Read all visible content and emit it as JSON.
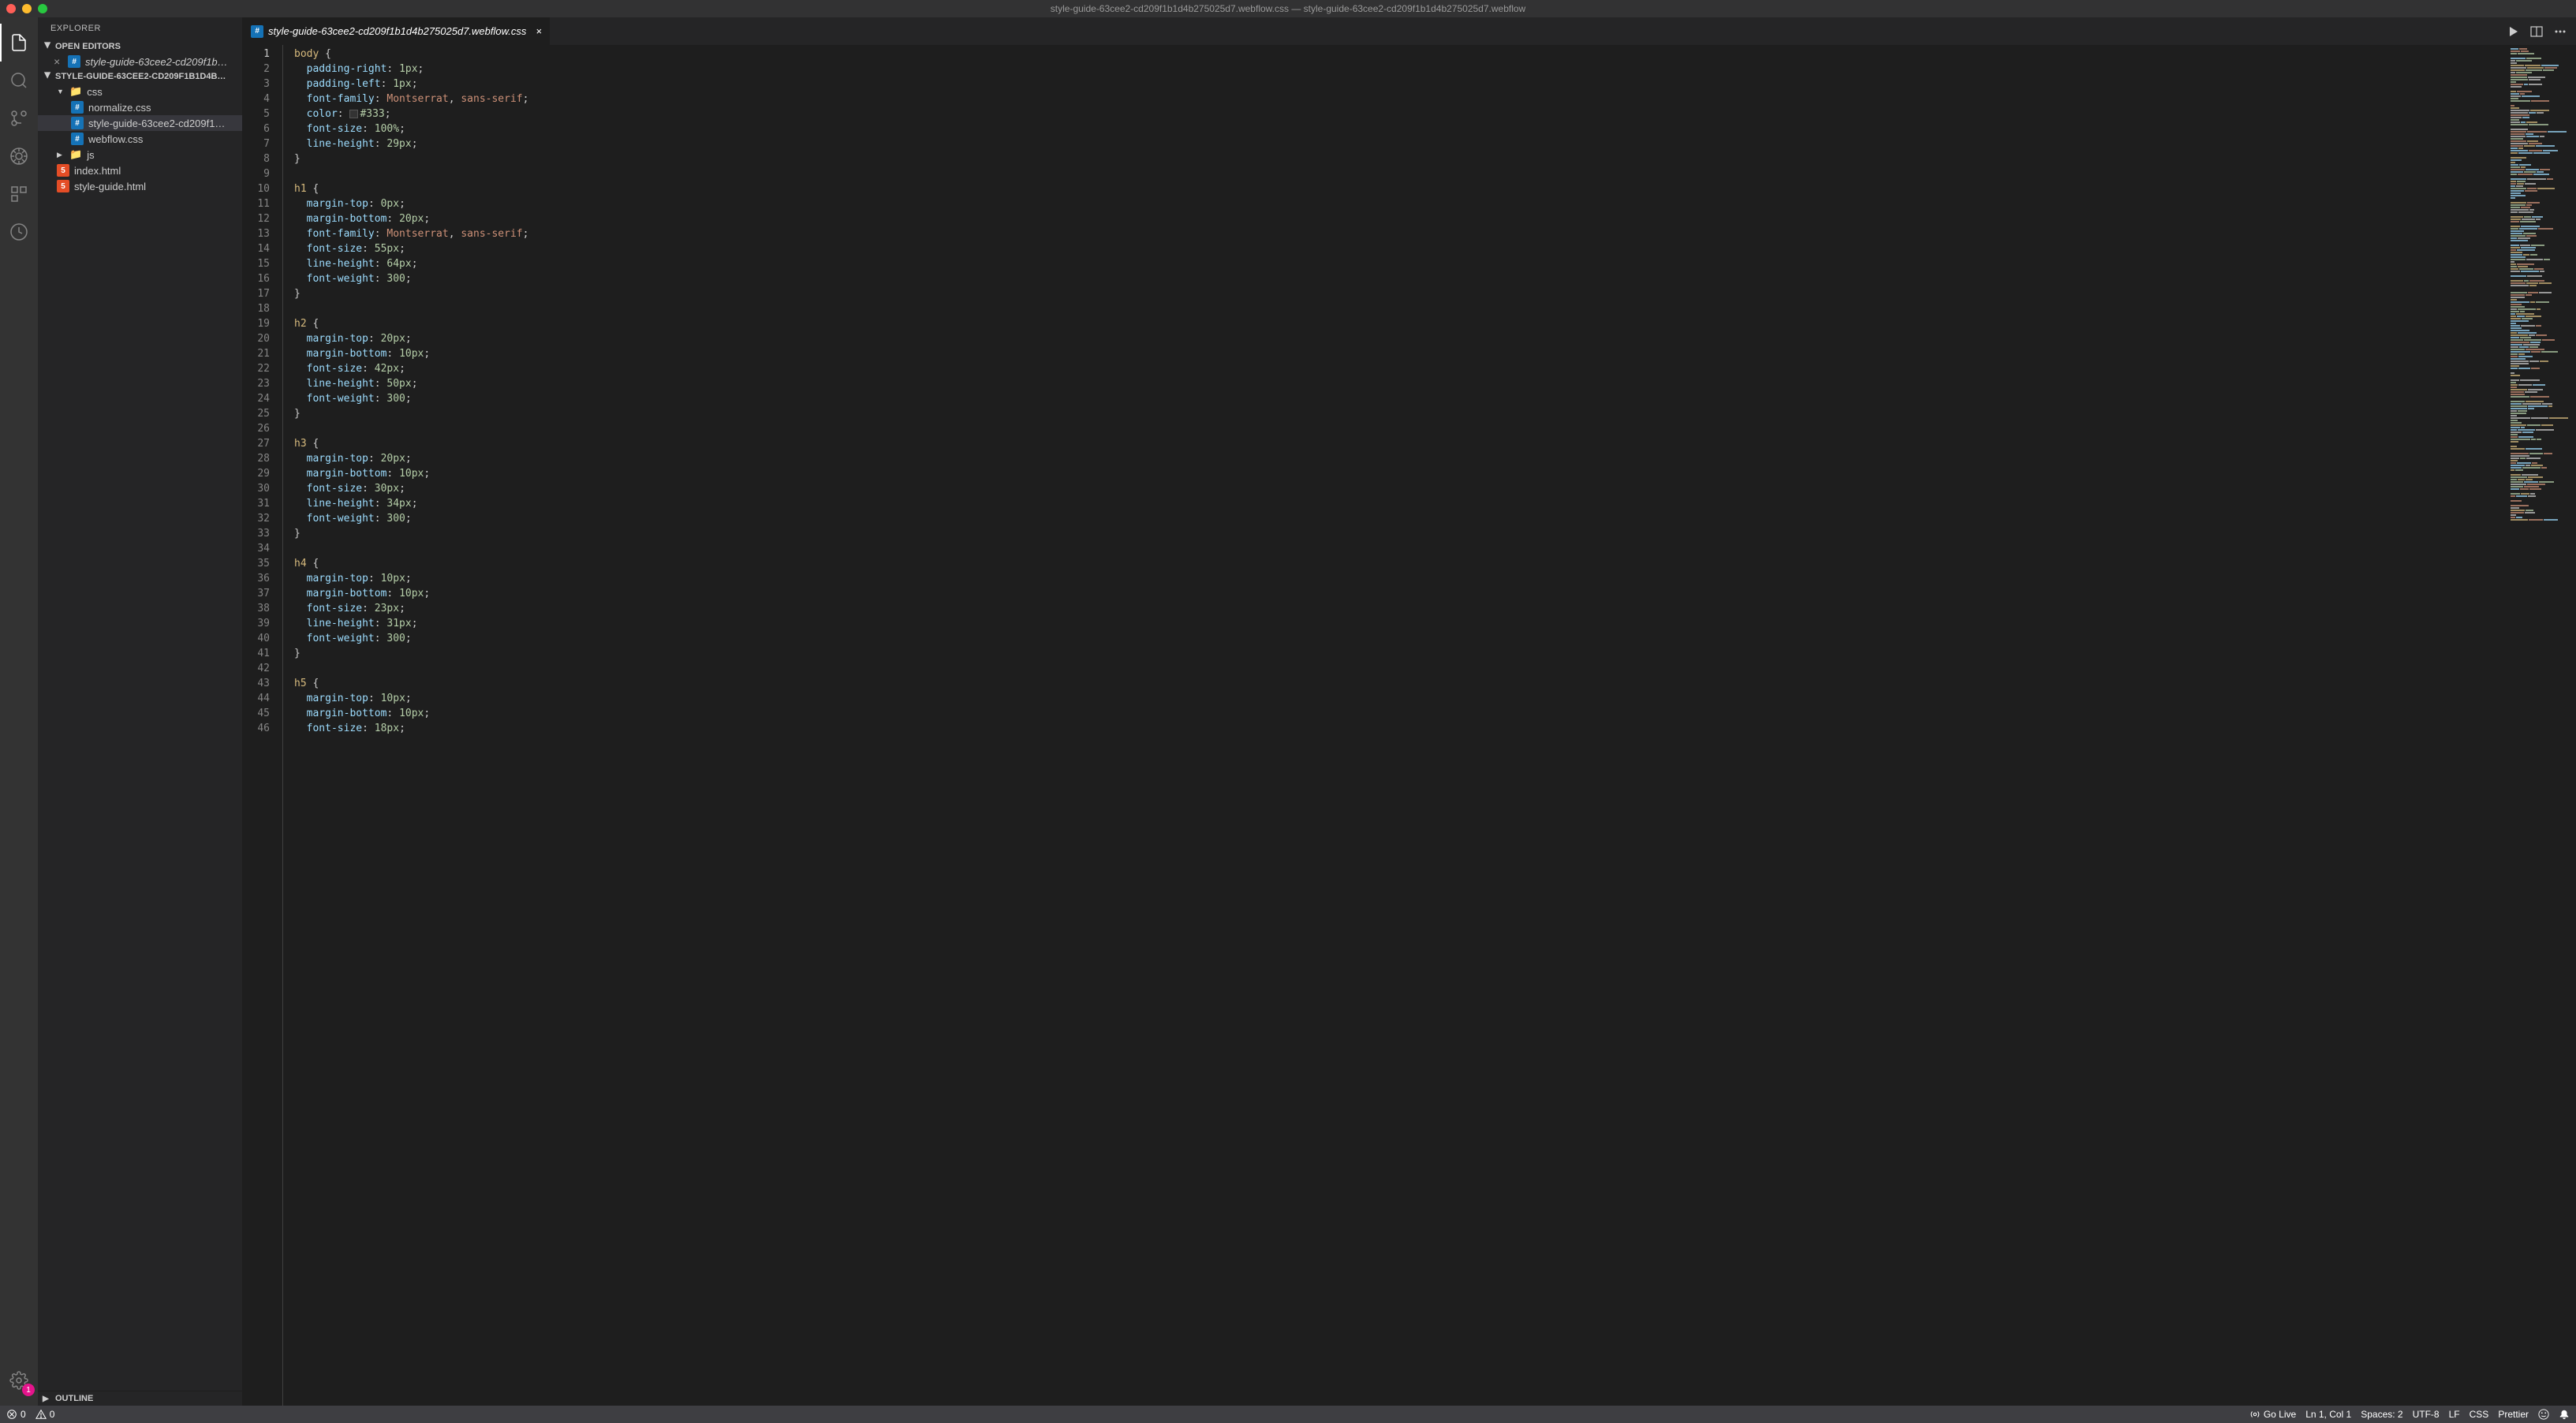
{
  "titlebar": {
    "title": "style-guide-63cee2-cd209f1b1d4b275025d7.webflow.css — style-guide-63cee2-cd209f1b1d4b275025d7.webflow"
  },
  "sidebar": {
    "title": "EXPLORER",
    "open_editors_label": "OPEN EDITORS",
    "open_editors": [
      {
        "name": "style-guide-63cee2-cd209f1b…",
        "icon": "css"
      }
    ],
    "workspace_name": "STYLE-GUIDE-63CEE2-CD209F1B1D4B…",
    "tree": [
      {
        "type": "folder",
        "name": "css",
        "indent": 1,
        "expanded": true,
        "root": true
      },
      {
        "type": "file",
        "name": "normalize.css",
        "icon": "css",
        "indent": 2
      },
      {
        "type": "file",
        "name": "style-guide-63cee2-cd209f1…",
        "icon": "css",
        "indent": 2,
        "active": true
      },
      {
        "type": "file",
        "name": "webflow.css",
        "icon": "css",
        "indent": 2
      },
      {
        "type": "folder",
        "name": "js",
        "indent": 1,
        "expanded": false
      },
      {
        "type": "file",
        "name": "index.html",
        "icon": "html",
        "indent": 1
      },
      {
        "type": "file",
        "name": "style-guide.html",
        "icon": "html",
        "indent": 1
      }
    ],
    "outline_label": "OUTLINE"
  },
  "tabs": [
    {
      "name": "style-guide-63cee2-cd209f1b1d4b275025d7.webflow.css",
      "icon": "css",
      "active": true
    }
  ],
  "code_lines": [
    [
      [
        "sel",
        "body"
      ],
      [
        "punc",
        " {"
      ]
    ],
    [
      [
        "punc",
        "  "
      ],
      [
        "prop",
        "padding-right"
      ],
      [
        "punc",
        ": "
      ],
      [
        "num",
        "1px"
      ],
      [
        "punc",
        ";"
      ]
    ],
    [
      [
        "punc",
        "  "
      ],
      [
        "prop",
        "padding-left"
      ],
      [
        "punc",
        ": "
      ],
      [
        "num",
        "1px"
      ],
      [
        "punc",
        ";"
      ]
    ],
    [
      [
        "punc",
        "  "
      ],
      [
        "prop",
        "font-family"
      ],
      [
        "punc",
        ": "
      ],
      [
        "str",
        "Montserrat"
      ],
      [
        "punc",
        ", "
      ],
      [
        "str",
        "sans-serif"
      ],
      [
        "punc",
        ";"
      ]
    ],
    [
      [
        "punc",
        "  "
      ],
      [
        "prop",
        "color"
      ],
      [
        "punc",
        ": "
      ],
      [
        "swatch",
        ""
      ],
      [
        "num",
        "#333"
      ],
      [
        "punc",
        ";"
      ]
    ],
    [
      [
        "punc",
        "  "
      ],
      [
        "prop",
        "font-size"
      ],
      [
        "punc",
        ": "
      ],
      [
        "num",
        "100%"
      ],
      [
        "punc",
        ";"
      ]
    ],
    [
      [
        "punc",
        "  "
      ],
      [
        "prop",
        "line-height"
      ],
      [
        "punc",
        ": "
      ],
      [
        "num",
        "29px"
      ],
      [
        "punc",
        ";"
      ]
    ],
    [
      [
        "punc",
        "}"
      ]
    ],
    [],
    [
      [
        "sel",
        "h1"
      ],
      [
        "punc",
        " {"
      ]
    ],
    [
      [
        "punc",
        "  "
      ],
      [
        "prop",
        "margin-top"
      ],
      [
        "punc",
        ": "
      ],
      [
        "num",
        "0px"
      ],
      [
        "punc",
        ";"
      ]
    ],
    [
      [
        "punc",
        "  "
      ],
      [
        "prop",
        "margin-bottom"
      ],
      [
        "punc",
        ": "
      ],
      [
        "num",
        "20px"
      ],
      [
        "punc",
        ";"
      ]
    ],
    [
      [
        "punc",
        "  "
      ],
      [
        "prop",
        "font-family"
      ],
      [
        "punc",
        ": "
      ],
      [
        "str",
        "Montserrat"
      ],
      [
        "punc",
        ", "
      ],
      [
        "str",
        "sans-serif"
      ],
      [
        "punc",
        ";"
      ]
    ],
    [
      [
        "punc",
        "  "
      ],
      [
        "prop",
        "font-size"
      ],
      [
        "punc",
        ": "
      ],
      [
        "num",
        "55px"
      ],
      [
        "punc",
        ";"
      ]
    ],
    [
      [
        "punc",
        "  "
      ],
      [
        "prop",
        "line-height"
      ],
      [
        "punc",
        ": "
      ],
      [
        "num",
        "64px"
      ],
      [
        "punc",
        ";"
      ]
    ],
    [
      [
        "punc",
        "  "
      ],
      [
        "prop",
        "font-weight"
      ],
      [
        "punc",
        ": "
      ],
      [
        "num",
        "300"
      ],
      [
        "punc",
        ";"
      ]
    ],
    [
      [
        "punc",
        "}"
      ]
    ],
    [],
    [
      [
        "sel",
        "h2"
      ],
      [
        "punc",
        " {"
      ]
    ],
    [
      [
        "punc",
        "  "
      ],
      [
        "prop",
        "margin-top"
      ],
      [
        "punc",
        ": "
      ],
      [
        "num",
        "20px"
      ],
      [
        "punc",
        ";"
      ]
    ],
    [
      [
        "punc",
        "  "
      ],
      [
        "prop",
        "margin-bottom"
      ],
      [
        "punc",
        ": "
      ],
      [
        "num",
        "10px"
      ],
      [
        "punc",
        ";"
      ]
    ],
    [
      [
        "punc",
        "  "
      ],
      [
        "prop",
        "font-size"
      ],
      [
        "punc",
        ": "
      ],
      [
        "num",
        "42px"
      ],
      [
        "punc",
        ";"
      ]
    ],
    [
      [
        "punc",
        "  "
      ],
      [
        "prop",
        "line-height"
      ],
      [
        "punc",
        ": "
      ],
      [
        "num",
        "50px"
      ],
      [
        "punc",
        ";"
      ]
    ],
    [
      [
        "punc",
        "  "
      ],
      [
        "prop",
        "font-weight"
      ],
      [
        "punc",
        ": "
      ],
      [
        "num",
        "300"
      ],
      [
        "punc",
        ";"
      ]
    ],
    [
      [
        "punc",
        "}"
      ]
    ],
    [],
    [
      [
        "sel",
        "h3"
      ],
      [
        "punc",
        " {"
      ]
    ],
    [
      [
        "punc",
        "  "
      ],
      [
        "prop",
        "margin-top"
      ],
      [
        "punc",
        ": "
      ],
      [
        "num",
        "20px"
      ],
      [
        "punc",
        ";"
      ]
    ],
    [
      [
        "punc",
        "  "
      ],
      [
        "prop",
        "margin-bottom"
      ],
      [
        "punc",
        ": "
      ],
      [
        "num",
        "10px"
      ],
      [
        "punc",
        ";"
      ]
    ],
    [
      [
        "punc",
        "  "
      ],
      [
        "prop",
        "font-size"
      ],
      [
        "punc",
        ": "
      ],
      [
        "num",
        "30px"
      ],
      [
        "punc",
        ";"
      ]
    ],
    [
      [
        "punc",
        "  "
      ],
      [
        "prop",
        "line-height"
      ],
      [
        "punc",
        ": "
      ],
      [
        "num",
        "34px"
      ],
      [
        "punc",
        ";"
      ]
    ],
    [
      [
        "punc",
        "  "
      ],
      [
        "prop",
        "font-weight"
      ],
      [
        "punc",
        ": "
      ],
      [
        "num",
        "300"
      ],
      [
        "punc",
        ";"
      ]
    ],
    [
      [
        "punc",
        "}"
      ]
    ],
    [],
    [
      [
        "sel",
        "h4"
      ],
      [
        "punc",
        " {"
      ]
    ],
    [
      [
        "punc",
        "  "
      ],
      [
        "prop",
        "margin-top"
      ],
      [
        "punc",
        ": "
      ],
      [
        "num",
        "10px"
      ],
      [
        "punc",
        ";"
      ]
    ],
    [
      [
        "punc",
        "  "
      ],
      [
        "prop",
        "margin-bottom"
      ],
      [
        "punc",
        ": "
      ],
      [
        "num",
        "10px"
      ],
      [
        "punc",
        ";"
      ]
    ],
    [
      [
        "punc",
        "  "
      ],
      [
        "prop",
        "font-size"
      ],
      [
        "punc",
        ": "
      ],
      [
        "num",
        "23px"
      ],
      [
        "punc",
        ";"
      ]
    ],
    [
      [
        "punc",
        "  "
      ],
      [
        "prop",
        "line-height"
      ],
      [
        "punc",
        ": "
      ],
      [
        "num",
        "31px"
      ],
      [
        "punc",
        ";"
      ]
    ],
    [
      [
        "punc",
        "  "
      ],
      [
        "prop",
        "font-weight"
      ],
      [
        "punc",
        ": "
      ],
      [
        "num",
        "300"
      ],
      [
        "punc",
        ";"
      ]
    ],
    [
      [
        "punc",
        "}"
      ]
    ],
    [],
    [
      [
        "sel",
        "h5"
      ],
      [
        "punc",
        " {"
      ]
    ],
    [
      [
        "punc",
        "  "
      ],
      [
        "prop",
        "margin-top"
      ],
      [
        "punc",
        ": "
      ],
      [
        "num",
        "10px"
      ],
      [
        "punc",
        ";"
      ]
    ],
    [
      [
        "punc",
        "  "
      ],
      [
        "prop",
        "margin-bottom"
      ],
      [
        "punc",
        ": "
      ],
      [
        "num",
        "10px"
      ],
      [
        "punc",
        ";"
      ]
    ],
    [
      [
        "punc",
        "  "
      ],
      [
        "prop",
        "font-size"
      ],
      [
        "punc",
        ": "
      ],
      [
        "num",
        "18px"
      ],
      [
        "punc",
        ";"
      ]
    ]
  ],
  "gutter_current": 1,
  "status": {
    "errors": "0",
    "warnings": "0",
    "go_live": "Go Live",
    "cursor": "Ln 1, Col 1",
    "spaces": "Spaces: 2",
    "encoding": "UTF-8",
    "eol": "LF",
    "language": "CSS",
    "prettier": "Prettier"
  },
  "badge_count": "1"
}
